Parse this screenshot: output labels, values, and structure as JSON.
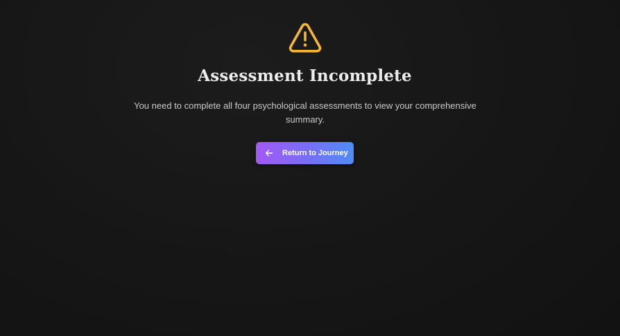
{
  "alert": {
    "icon": "warning-triangle-icon",
    "icon_color": "#f6b731",
    "title": "Assessment Incomplete",
    "message": "You need to complete all four psychological assessments to view your comprehensive summary."
  },
  "action": {
    "icon": "arrow-left-icon",
    "label": "Return to Journey",
    "gradient_start": "#a259f5",
    "gradient_end": "#4f8cf6"
  }
}
